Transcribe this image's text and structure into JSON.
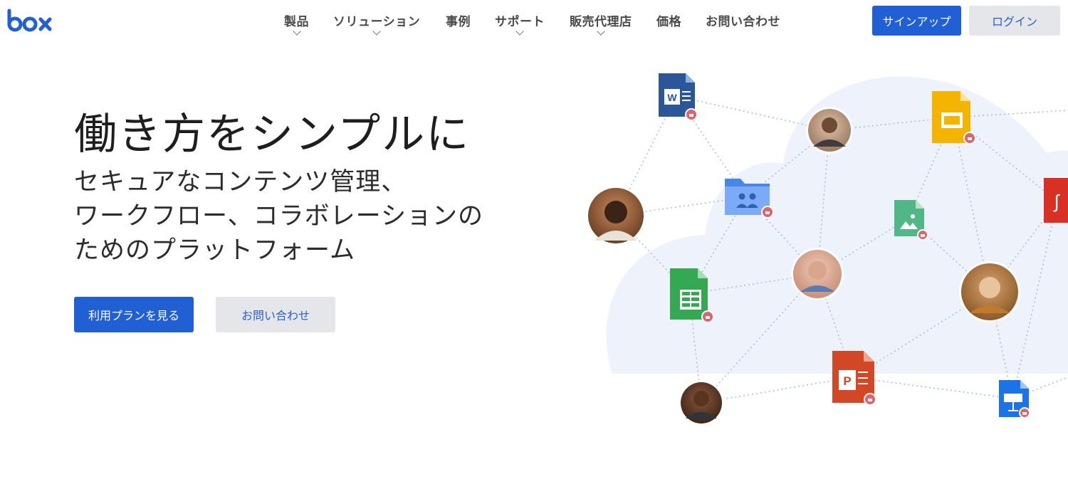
{
  "header": {
    "logo_text": "box",
    "nav": [
      {
        "label": "製品",
        "has_dropdown": true
      },
      {
        "label": "ソリューション",
        "has_dropdown": true
      },
      {
        "label": "事例",
        "has_dropdown": false
      },
      {
        "label": "サポート",
        "has_dropdown": true
      },
      {
        "label": "販売代理店",
        "has_dropdown": true
      },
      {
        "label": "価格",
        "has_dropdown": false
      },
      {
        "label": "お問い合わせ",
        "has_dropdown": false
      }
    ],
    "signup_label": "サインアップ",
    "login_label": "ログイン"
  },
  "hero": {
    "title": "働き方をシンプルに",
    "subtitle_lines": [
      "セキュアなコンテンツ管理、",
      "ワークフロー、コラボレーションの",
      "ためのプラットフォーム"
    ],
    "primary_cta": "利用プランを見る",
    "secondary_cta": "お問い合わせ"
  },
  "illustration": {
    "icons": [
      "word-file-icon",
      "slides-file-icon",
      "pdf-file-icon",
      "shared-folder-icon",
      "image-file-icon",
      "sheets-file-icon",
      "powerpoint-file-icon",
      "keynote-file-icon",
      "lock-badge-icon"
    ]
  },
  "colors": {
    "brand_blue": "#2160d4",
    "secondary_button": "#e4e6ea",
    "cloud": "#eef3fb",
    "lock_badge": "#e0626a"
  }
}
